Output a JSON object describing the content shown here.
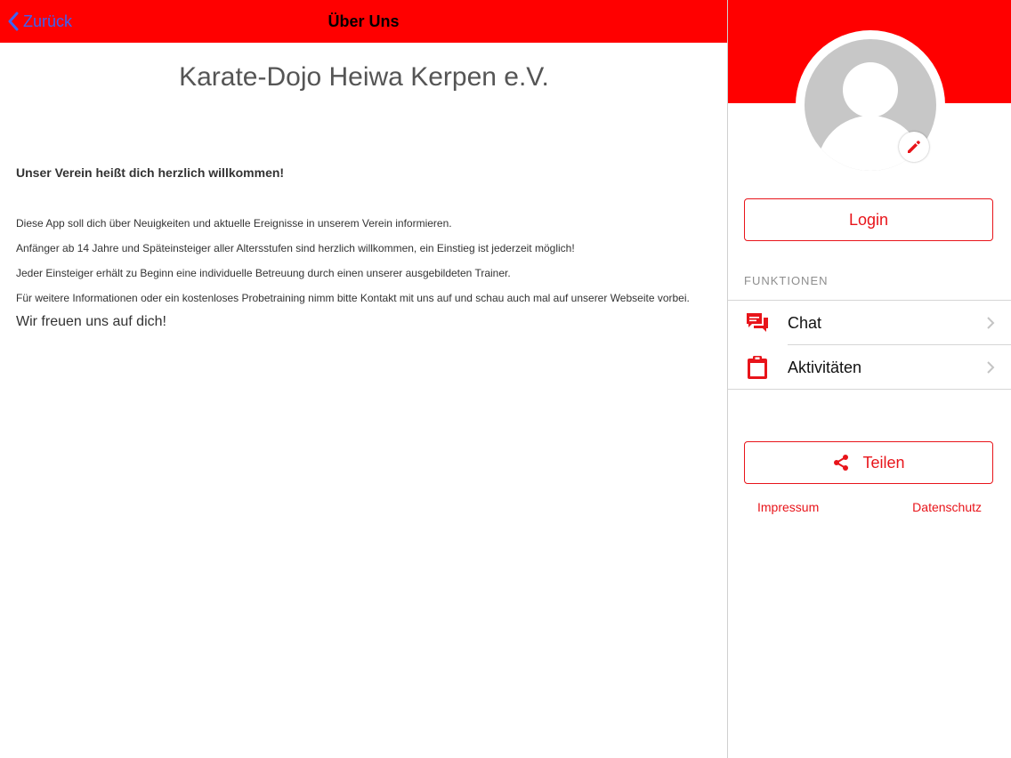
{
  "colors": {
    "brand_red": "#ff0000",
    "accent_red": "#e8141a",
    "link_blue": "#3a63f5"
  },
  "navbar": {
    "back_label": "Zurück",
    "back_icon": "chevron-left-icon",
    "title": "Über Uns"
  },
  "about": {
    "club_name": "Karate-Dojo Heiwa Kerpen e.V.",
    "welcome": "Unser Verein heißt dich herzlich willkommen!",
    "paragraphs": [
      "Diese App soll dich über Neuigkeiten und aktuelle Ereignisse in unserem Verein informieren.",
      "Anfänger ab 14 Jahre und Späteinsteiger aller Altersstufen sind herzlich willkommen, ein Einstieg ist jederzeit möglich!",
      "Jeder Einsteiger erhält zu Beginn eine individuelle Betreuung durch einen unserer ausgebildeten Trainer.",
      "Für weitere Informationen oder ein kostenloses Probetraining nimm bitte Kontakt mit uns auf und schau auch mal auf unserer Webseite vorbei."
    ],
    "closing": "Wir freuen uns auf dich!"
  },
  "sidebar": {
    "avatar_icon": "user-placeholder-icon",
    "edit_icon": "pencil-icon",
    "login_label": "Login",
    "section_title": "FUNKTIONEN",
    "items": [
      {
        "label": "Chat",
        "icon": "chat-bubbles-icon"
      },
      {
        "label": "Aktivitäten",
        "icon": "clipboard-icon"
      }
    ],
    "share_label": "Teilen",
    "share_icon": "share-icon",
    "impressum_label": "Impressum",
    "datenschutz_label": "Datenschutz"
  }
}
